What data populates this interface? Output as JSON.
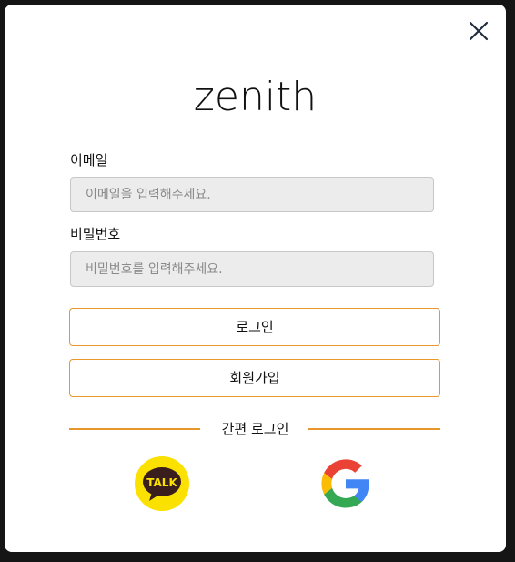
{
  "modal": {
    "logo_text": "zenith",
    "close_icon": "close-icon"
  },
  "email": {
    "label": "이메일",
    "placeholder": "이메일을 입력해주세요.",
    "value": ""
  },
  "password": {
    "label": "비밀번호",
    "placeholder": "비밀번호를 입력해주세요.",
    "value": ""
  },
  "buttons": {
    "login_label": "로그인",
    "signup_label": "회원가입"
  },
  "social": {
    "divider_label": "간편 로그인",
    "kakao": {
      "icon": "kakao-talk-icon",
      "text": "TALK",
      "bg": "#fae100",
      "fg": "#3a1d1d"
    },
    "google": {
      "icon": "google-icon"
    }
  },
  "colors": {
    "accent": "#e8972b",
    "backdrop": "#151515",
    "input_bg": "#ececec"
  }
}
